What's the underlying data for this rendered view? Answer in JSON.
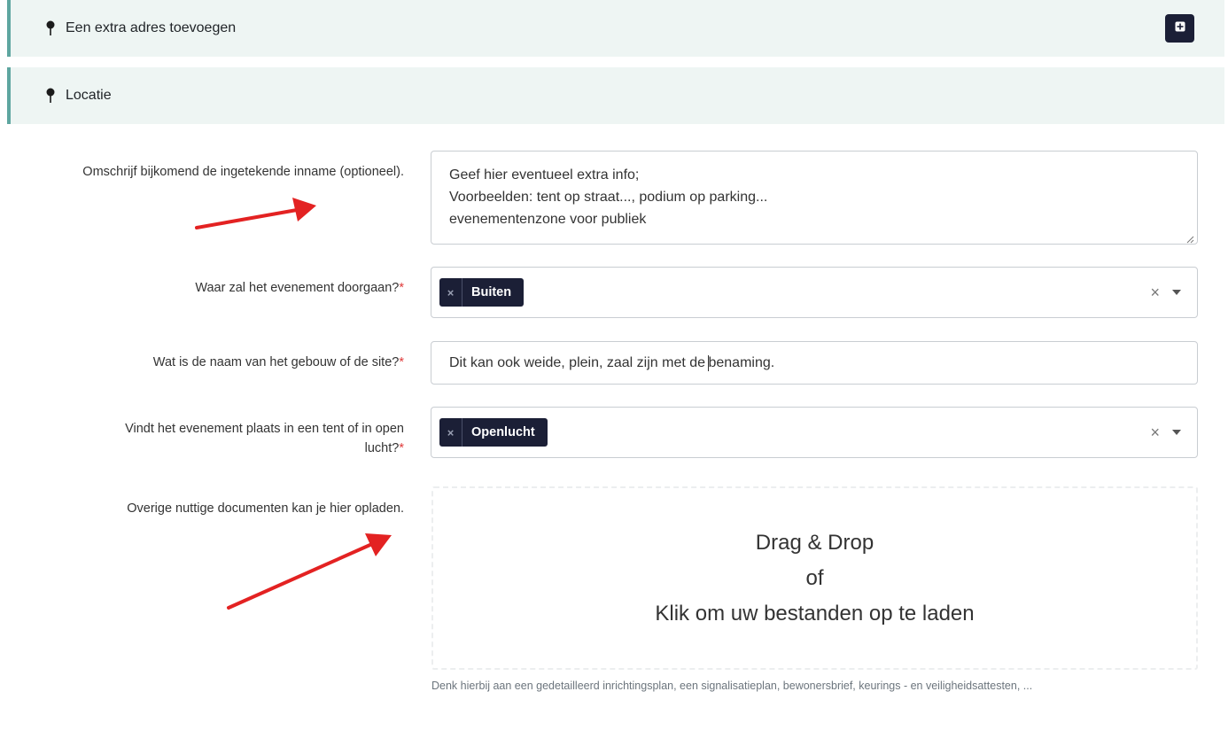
{
  "sections": {
    "extra_address": {
      "title": "Een extra adres toevoegen",
      "icon": "map-pin-icon",
      "action_icon": "plus-square-icon"
    },
    "locatie": {
      "title": "Locatie",
      "icon": "map-pin-icon"
    }
  },
  "form": {
    "omschrijving": {
      "label": "Omschrijf bijkomend de ingetekende inname (optioneel).",
      "value": "Geef hier eventueel extra info;\nVoorbeelden:  tent op straat..., podium op parking...\n evenementenzone voor publiek"
    },
    "waar": {
      "label": "Waar zal het evenement doorgaan?",
      "required_mark": "*",
      "selected": "Buiten",
      "tag_remove": "×",
      "clear": "×"
    },
    "naam": {
      "label": "Wat is de naam van het gebouw of de site?",
      "required_mark": "*",
      "value_before_cursor": "Dit kan ook weide, plein, zaal zijn met de ",
      "value_after_cursor": "benaming."
    },
    "tent": {
      "label_line1": "Vindt het evenement plaats in een tent of in open",
      "label_line2": "lucht?",
      "required_mark": "*",
      "selected": "Openlucht",
      "tag_remove": "×",
      "clear": "×"
    },
    "documenten": {
      "label": "Overige nuttige documenten kan je hier opladen.",
      "dropzone_line1": "Drag & Drop",
      "dropzone_line2": "of",
      "dropzone_line3": "Klik om uw bestanden op te laden",
      "help": "Denk hierbij aan een gedetailleerd inrichtingsplan, een signalisatieplan, bewonersbrief, keurings - en veiligheidsattesten, ..."
    }
  },
  "colors": {
    "section_bg": "#eef5f3",
    "section_accent": "#5ea6a0",
    "tag_bg": "#1b1f36",
    "required": "#e03b3b",
    "annotation_arrow": "#e32222"
  }
}
